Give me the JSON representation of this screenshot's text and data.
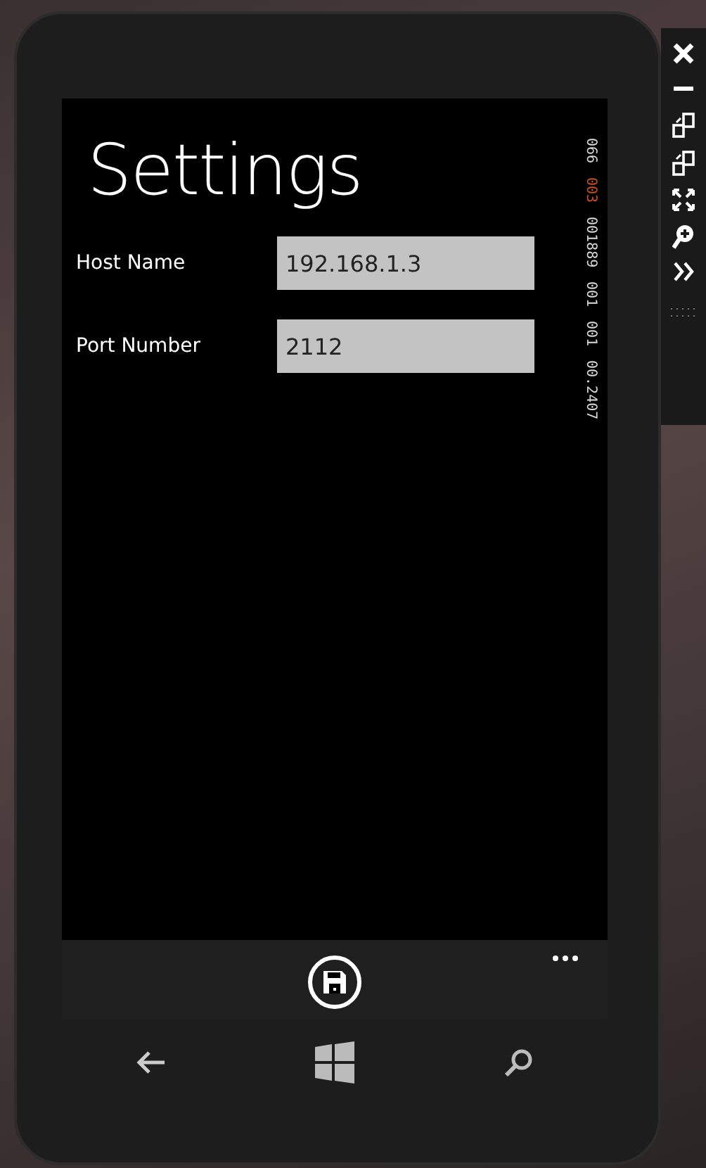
{
  "page": {
    "title": "Settings"
  },
  "fields": [
    {
      "label": "Host Name",
      "value": "192.168.1.3"
    },
    {
      "label": "Port Number",
      "value": "2112"
    }
  ],
  "frame_counters": [
    {
      "text": "066",
      "color": "#d8d8d8"
    },
    {
      "text": "003",
      "color": "#c8501e"
    },
    {
      "text": "001889",
      "color": "#d8d8d8"
    },
    {
      "text": "001",
      "color": "#d8d8d8"
    },
    {
      "text": "001",
      "color": "#d8d8d8"
    },
    {
      "text": "00.2407",
      "color": "#d8d8d8"
    }
  ]
}
